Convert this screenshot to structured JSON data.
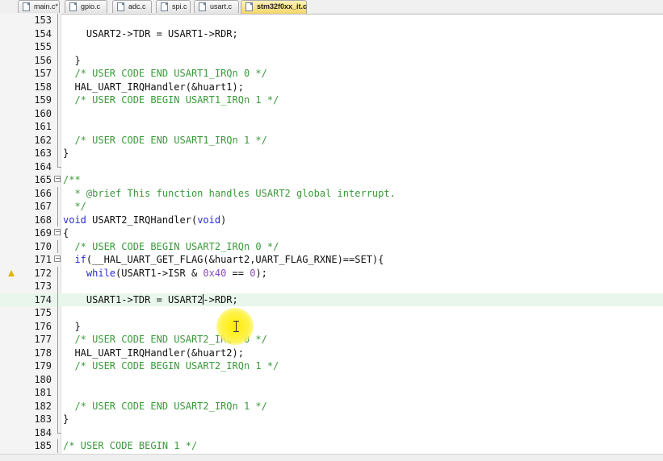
{
  "tabs": [
    {
      "label": "main.c*",
      "active": false
    },
    {
      "label": "gpio.c",
      "active": false
    },
    {
      "label": "adc.c",
      "active": false
    },
    {
      "label": "spi.c",
      "active": false
    },
    {
      "label": "usart.c",
      "active": false
    },
    {
      "label": "stm32f0xx_it.c",
      "active": true
    }
  ],
  "editor": {
    "highlighted_line": 174,
    "warning_line": 172,
    "lines": [
      {
        "n": "153",
        "code": ""
      },
      {
        "n": "154",
        "code": "    USART2->TDR = USART1->RDR;"
      },
      {
        "n": "155",
        "code": ""
      },
      {
        "n": "156",
        "code": "  }"
      },
      {
        "n": "157",
        "code": "  /* USER CODE END USART1_IRQn 0 */"
      },
      {
        "n": "158",
        "code": "  HAL_UART_IRQHandler(&huart1);"
      },
      {
        "n": "159",
        "code": "  /* USER CODE BEGIN USART1_IRQn 1 */"
      },
      {
        "n": "160",
        "code": ""
      },
      {
        "n": "161",
        "code": ""
      },
      {
        "n": "162",
        "code": "  /* USER CODE END USART1_IRQn 1 */"
      },
      {
        "n": "163",
        "code": "}"
      },
      {
        "n": "164",
        "code": ""
      },
      {
        "n": "165",
        "code": "/**"
      },
      {
        "n": "166",
        "code": "  * @brief This function handles USART2 global interrupt."
      },
      {
        "n": "167",
        "code": "  */"
      },
      {
        "n": "168",
        "code": "void USART2_IRQHandler(void)"
      },
      {
        "n": "169",
        "code": "{"
      },
      {
        "n": "170",
        "code": "  /* USER CODE BEGIN USART2_IRQn 0 */"
      },
      {
        "n": "171",
        "code": "  if(__HAL_UART_GET_FLAG(&huart2,UART_FLAG_RXNE)==SET){"
      },
      {
        "n": "172",
        "code": "    while(USART1->ISR & 0x40 == 0);"
      },
      {
        "n": "173",
        "code": ""
      },
      {
        "n": "174",
        "code": "    USART1->TDR = USART2->RDR;"
      },
      {
        "n": "175",
        "code": ""
      },
      {
        "n": "176",
        "code": "  }"
      },
      {
        "n": "177",
        "code": "  /* USER CODE END USART2_IRQn 0 */"
      },
      {
        "n": "178",
        "code": "  HAL_UART_IRQHandler(&huart2);"
      },
      {
        "n": "179",
        "code": "  /* USER CODE BEGIN USART2_IRQn 1 */"
      },
      {
        "n": "180",
        "code": ""
      },
      {
        "n": "181",
        "code": ""
      },
      {
        "n": "182",
        "code": "  /* USER CODE END USART2_IRQn 1 */"
      },
      {
        "n": "183",
        "code": "}"
      },
      {
        "n": "184",
        "code": ""
      },
      {
        "n": "185",
        "code": "/* USER CODE BEGIN 1 */"
      }
    ]
  }
}
